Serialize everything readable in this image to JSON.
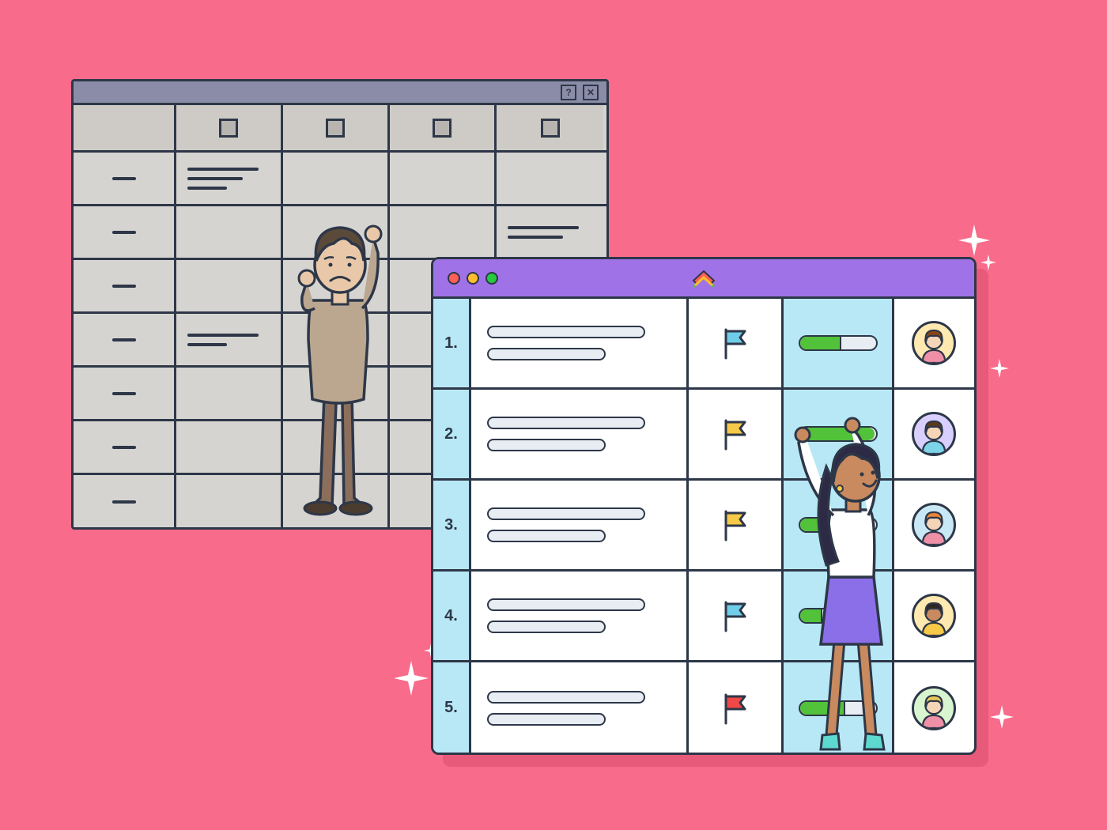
{
  "old_window": {
    "titlebar": {
      "help_label": "?",
      "close_label": "✕"
    },
    "header_cols": 5,
    "rows": 7
  },
  "new_window": {
    "rows": [
      {
        "num": "1.",
        "flag_color": "#6FCDE8",
        "progress": 55,
        "avatar_bg": "#FFE9B0",
        "avatar_hair": "#8B4513",
        "avatar_skin": "#F5D5B8",
        "avatar_body": "#F08FA8"
      },
      {
        "num": "2.",
        "flag_color": "#F7C948",
        "progress": 98,
        "avatar_bg": "#D8CFFF",
        "avatar_hair": "#5B3A1A",
        "avatar_skin": "#F5D5B8",
        "avatar_body": "#7DD3E8"
      },
      {
        "num": "3.",
        "flag_color": "#F7C948",
        "progress": 35,
        "avatar_bg": "#C8E8F5",
        "avatar_hair": "#E8843C",
        "avatar_skin": "#F5D5B8",
        "avatar_body": "#F08FA8"
      },
      {
        "num": "4.",
        "flag_color": "#6FCDE8",
        "progress": 30,
        "avatar_bg": "#FFE9B0",
        "avatar_hair": "#2D2520",
        "avatar_skin": "#C88A5E",
        "avatar_body": "#F7C948"
      },
      {
        "num": "5.",
        "flag_color": "#F04747",
        "progress": 60,
        "avatar_bg": "#D8F5D0",
        "avatar_hair": "#E8C85A",
        "avatar_skin": "#F5D5B8",
        "avatar_body": "#F08FA8"
      }
    ]
  }
}
